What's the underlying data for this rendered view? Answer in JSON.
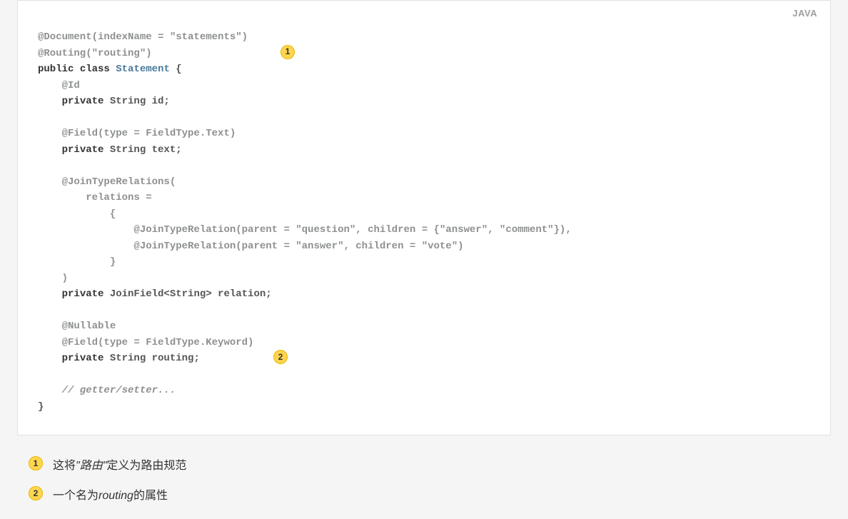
{
  "language_label": "JAVA",
  "code": {
    "l1": "@Document(indexName = \"statements\")",
    "l2": "@Routing(\"routing\")",
    "l3a": "public",
    "l3b": "class",
    "l3c": "Statement",
    "l3d": " {",
    "l4": "    @Id",
    "l5a": "    ",
    "l5b": "private",
    "l5c": " String id;",
    "l6": " ",
    "l7": "    @Field(type = FieldType.Text)",
    "l8a": "    ",
    "l8b": "private",
    "l8c": " String text;",
    "l9": " ",
    "l10": "    @JoinTypeRelations(",
    "l11": "        relations =",
    "l12": "            {",
    "l13": "                @JoinTypeRelation(parent = \"question\", children = {\"answer\", \"comment\"}),",
    "l14": "                @JoinTypeRelation(parent = \"answer\", children = \"vote\")",
    "l15": "            }",
    "l16": "    )",
    "l17a": "    ",
    "l17b": "private",
    "l17c": " JoinField<String> relation;",
    "l18": " ",
    "l19": "    @Nullable",
    "l20": "    @Field(type = FieldType.Keyword)",
    "l21a": "    ",
    "l21b": "private",
    "l21c": " String routing;",
    "l22": " ",
    "l23": "    // getter/setter...",
    "l24": "}"
  },
  "callout_markers": {
    "m1": "1",
    "m2": "2"
  },
  "callouts": [
    {
      "num": "1",
      "text_pre": "这将",
      "text_em": "\"路由\"",
      "text_post": "定义为路由规范"
    },
    {
      "num": "2",
      "text_pre": "一个名为",
      "text_em": "routing",
      "text_post": "的属性"
    }
  ]
}
